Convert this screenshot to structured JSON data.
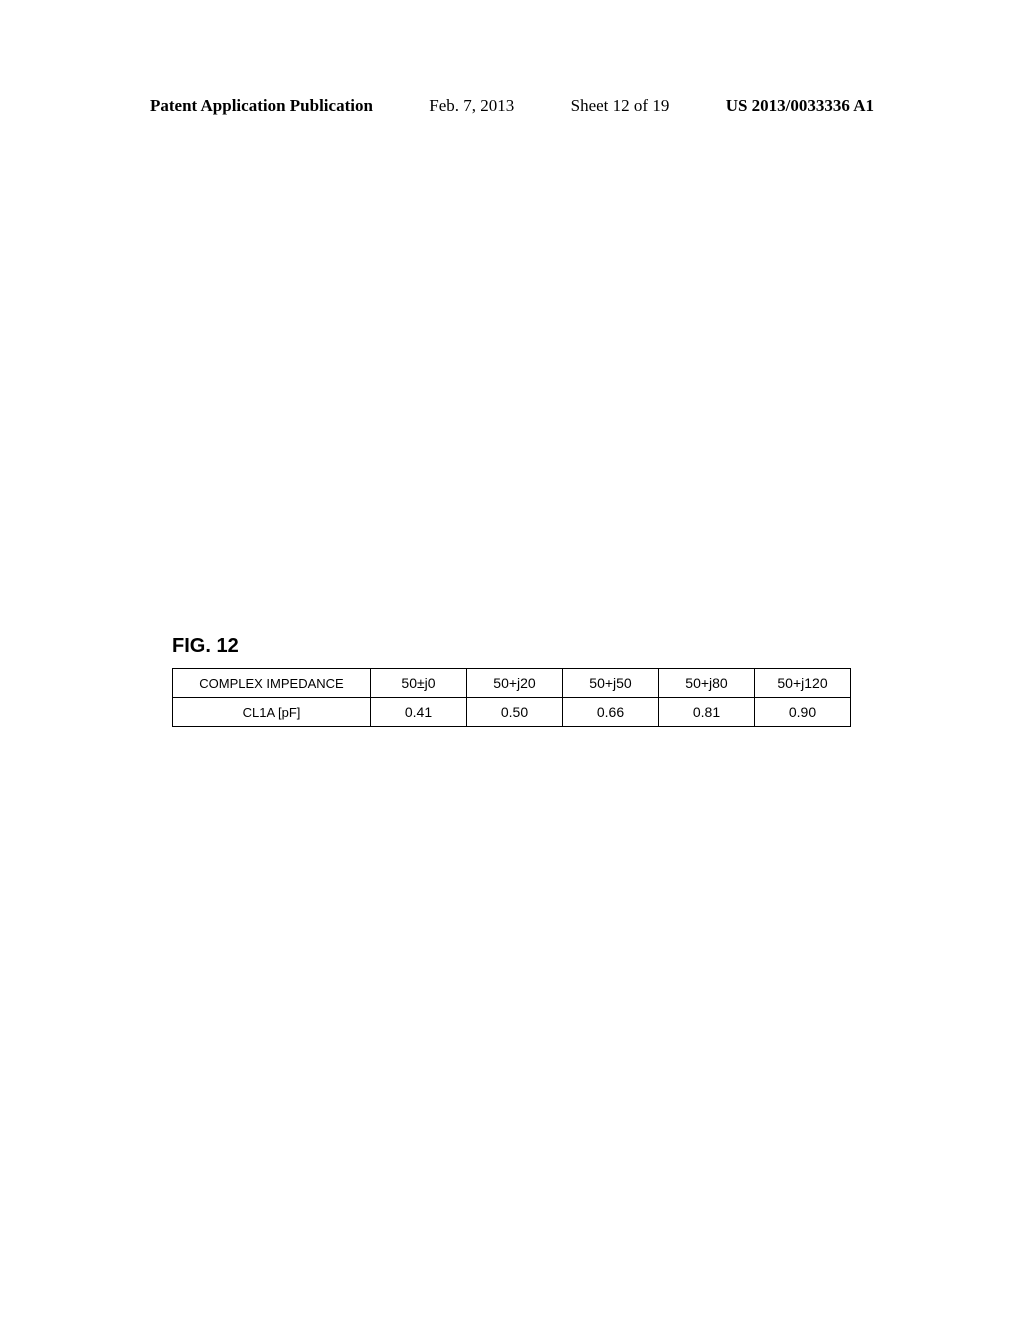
{
  "header": {
    "pubtype": "Patent Application Publication",
    "date": "Feb. 7, 2013",
    "sheet": "Sheet 12 of 19",
    "pubnum": "US 2013/0033336 A1"
  },
  "figure": {
    "label": "FIG. 12"
  },
  "chart_data": {
    "type": "table",
    "title": "FIG. 12",
    "rows": [
      {
        "label": "COMPLEX IMPEDANCE",
        "values": [
          "50±j0",
          "50+j20",
          "50+j50",
          "50+j80",
          "50+j120"
        ]
      },
      {
        "label": "CL1A [pF]",
        "values": [
          "0.41",
          "0.50",
          "0.66",
          "0.81",
          "0.90"
        ]
      }
    ]
  }
}
